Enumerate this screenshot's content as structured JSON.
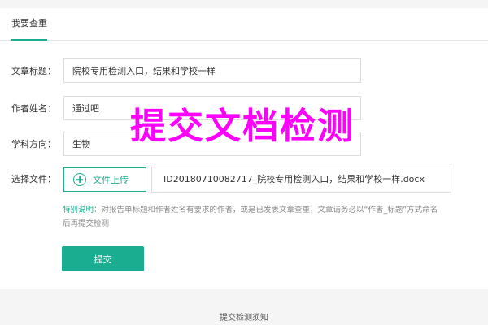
{
  "tabs": [
    {
      "label": "我要查重",
      "active": true
    }
  ],
  "form": {
    "title": {
      "label": "文章标题：",
      "value": "院校专用检测入口，结果和学校一样"
    },
    "author": {
      "label": "作者姓名：",
      "value": "通过吧"
    },
    "subject": {
      "label": "学科方向：",
      "value": "生物"
    },
    "file": {
      "label": "选择文件：",
      "upload_label": "文件上传",
      "file_name": "ID20180710082717_院校专用检测入口，结果和学校一样.docx"
    }
  },
  "note": {
    "key": "特别说明",
    "text": "：对报告单标题和作者姓名有要求的作者，或是已发表文章查重，文章请务必以“作者_标题”方式命名后再提交检测"
  },
  "submit_label": "提交",
  "footer": {
    "notice_title": "提交检测须知"
  },
  "overlay": {
    "text": "提交文档检测"
  },
  "colors": {
    "accent": "#1aad8f",
    "overlay": "#ff00ff",
    "border": "#dcdcdc",
    "muted": "#888888"
  },
  "icons": {
    "upload": "plus-circle-icon"
  }
}
